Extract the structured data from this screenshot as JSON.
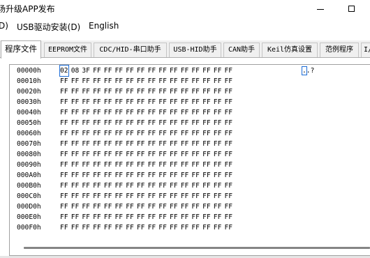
{
  "window": {
    "title": "场升级APP发布",
    "minimize_symbol": "—",
    "maximize_symbol": "□"
  },
  "menu": {
    "items": [
      "D)",
      "USB驱动安装(D)",
      "English"
    ]
  },
  "tabs": [
    "程序文件",
    "EEPROM文件",
    "CDC/HID-串口助手",
    "USB-HID助手",
    "CAN助手",
    "Keil仿真设置",
    "范例程序",
    "I/"
  ],
  "active_tab_index": 0,
  "hex_view": {
    "rows": [
      {
        "address": "00000h",
        "bytes": [
          "02",
          "08",
          "3F",
          "FF",
          "FF",
          "FF",
          "FF",
          "FF",
          "FF",
          "FF",
          "FF",
          "FF",
          "FF",
          "FF",
          "FF",
          "FF"
        ],
        "ascii": "..?"
      },
      {
        "address": "00010h",
        "bytes": [
          "FF",
          "FF",
          "FF",
          "FF",
          "FF",
          "FF",
          "FF",
          "FF",
          "FF",
          "FF",
          "FF",
          "FF",
          "FF",
          "FF",
          "FF",
          "FF"
        ],
        "ascii": ""
      },
      {
        "address": "00020h",
        "bytes": [
          "FF",
          "FF",
          "FF",
          "FF",
          "FF",
          "FF",
          "FF",
          "FF",
          "FF",
          "FF",
          "FF",
          "FF",
          "FF",
          "FF",
          "FF",
          "FF"
        ],
        "ascii": ""
      },
      {
        "address": "00030h",
        "bytes": [
          "FF",
          "FF",
          "FF",
          "FF",
          "FF",
          "FF",
          "FF",
          "FF",
          "FF",
          "FF",
          "FF",
          "FF",
          "FF",
          "FF",
          "FF",
          "FF"
        ],
        "ascii": ""
      },
      {
        "address": "00040h",
        "bytes": [
          "FF",
          "FF",
          "FF",
          "FF",
          "FF",
          "FF",
          "FF",
          "FF",
          "FF",
          "FF",
          "FF",
          "FF",
          "FF",
          "FF",
          "FF",
          "FF"
        ],
        "ascii": ""
      },
      {
        "address": "00050h",
        "bytes": [
          "FF",
          "FF",
          "FF",
          "FF",
          "FF",
          "FF",
          "FF",
          "FF",
          "FF",
          "FF",
          "FF",
          "FF",
          "FF",
          "FF",
          "FF",
          "FF"
        ],
        "ascii": ""
      },
      {
        "address": "00060h",
        "bytes": [
          "FF",
          "FF",
          "FF",
          "FF",
          "FF",
          "FF",
          "FF",
          "FF",
          "FF",
          "FF",
          "FF",
          "FF",
          "FF",
          "FF",
          "FF",
          "FF"
        ],
        "ascii": ""
      },
      {
        "address": "00070h",
        "bytes": [
          "FF",
          "FF",
          "FF",
          "FF",
          "FF",
          "FF",
          "FF",
          "FF",
          "FF",
          "FF",
          "FF",
          "FF",
          "FF",
          "FF",
          "FF",
          "FF"
        ],
        "ascii": ""
      },
      {
        "address": "00080h",
        "bytes": [
          "FF",
          "FF",
          "FF",
          "FF",
          "FF",
          "FF",
          "FF",
          "FF",
          "FF",
          "FF",
          "FF",
          "FF",
          "FF",
          "FF",
          "FF",
          "FF"
        ],
        "ascii": ""
      },
      {
        "address": "00090h",
        "bytes": [
          "FF",
          "FF",
          "FF",
          "FF",
          "FF",
          "FF",
          "FF",
          "FF",
          "FF",
          "FF",
          "FF",
          "FF",
          "FF",
          "FF",
          "FF",
          "FF"
        ],
        "ascii": ""
      },
      {
        "address": "000A0h",
        "bytes": [
          "FF",
          "FF",
          "FF",
          "FF",
          "FF",
          "FF",
          "FF",
          "FF",
          "FF",
          "FF",
          "FF",
          "FF",
          "FF",
          "FF",
          "FF",
          "FF"
        ],
        "ascii": ""
      },
      {
        "address": "000B0h",
        "bytes": [
          "FF",
          "FF",
          "FF",
          "FF",
          "FF",
          "FF",
          "FF",
          "FF",
          "FF",
          "FF",
          "FF",
          "FF",
          "FF",
          "FF",
          "FF",
          "FF"
        ],
        "ascii": ""
      },
      {
        "address": "000C0h",
        "bytes": [
          "FF",
          "FF",
          "FF",
          "FF",
          "FF",
          "FF",
          "FF",
          "FF",
          "FF",
          "FF",
          "FF",
          "FF",
          "FF",
          "FF",
          "FF",
          "FF"
        ],
        "ascii": ""
      },
      {
        "address": "000D0h",
        "bytes": [
          "FF",
          "FF",
          "FF",
          "FF",
          "FF",
          "FF",
          "FF",
          "FF",
          "FF",
          "FF",
          "FF",
          "FF",
          "FF",
          "FF",
          "FF",
          "FF"
        ],
        "ascii": ""
      },
      {
        "address": "000E0h",
        "bytes": [
          "FF",
          "FF",
          "FF",
          "FF",
          "FF",
          "FF",
          "FF",
          "FF",
          "FF",
          "FF",
          "FF",
          "FF",
          "FF",
          "FF",
          "FF",
          "FF"
        ],
        "ascii": ""
      },
      {
        "address": "000F0h",
        "bytes": [
          "FF",
          "FF",
          "FF",
          "FF",
          "FF",
          "FF",
          "FF",
          "FF",
          "FF",
          "FF",
          "FF",
          "FF",
          "FF",
          "FF",
          "FF",
          "FF"
        ],
        "ascii": ""
      }
    ],
    "selected_byte": {
      "row": 0,
      "col": 0
    },
    "selected_ascii": {
      "row": 0,
      "index": 0
    },
    "selection_color": "#1a6bd6"
  }
}
